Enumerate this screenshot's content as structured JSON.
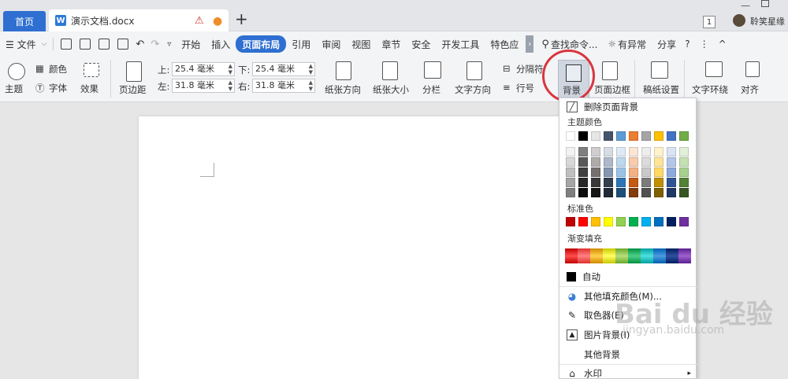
{
  "window": {
    "home_tab": "首页",
    "doc_tab": "演示文档.docx",
    "doc_icon_letter": "W",
    "new_tab": "+",
    "tab_count": "1",
    "user_name": "聆笑星缘"
  },
  "menubar": {
    "file": "☰ 文件",
    "items": [
      "开始",
      "插入",
      "页面布局",
      "引用",
      "审阅",
      "视图",
      "章节",
      "安全",
      "开发工具",
      "特色应"
    ],
    "active_item": "页面布局",
    "search": "查找命令...",
    "exception": "有异常",
    "share": "分享"
  },
  "ribbon": {
    "theme": "主题",
    "colors": "颜色",
    "fonts": "字体",
    "effects": "效果",
    "margins": "页边距",
    "top_label": "上:",
    "top_value": "25.4 毫米",
    "bottom_label": "下:",
    "bottom_value": "25.4 毫米",
    "left_label": "左:",
    "left_value": "31.8 毫米",
    "right_label": "右:",
    "right_value": "31.8 毫米",
    "orientation": "纸张方向",
    "size": "纸张大小",
    "columns": "分栏",
    "text_direction": "文字方向",
    "separator": "分隔符",
    "line_number": "行号",
    "background": "背景",
    "page_border": "页面边框",
    "paper_settings": "稿纸设置",
    "text_wrap": "文字环绕",
    "align": "对齐"
  },
  "dropdown": {
    "remove_bg": "删除页面背景",
    "theme_colors_title": "主题颜色",
    "standard_colors_title": "标准色",
    "gradient_title": "渐变填充",
    "auto": "自动",
    "more_fill": "其他填充颜色(M)...",
    "eyedropper": "取色器(E)",
    "picture_bg": "图片背景(I)",
    "other_bg": "其他背景",
    "watermark": "水印",
    "theme_top_row": [
      "#ffffff",
      "#000000",
      "#e7e6e6",
      "#44546a",
      "#5b9bd5",
      "#ed7d31",
      "#a5a5a5",
      "#ffc000",
      "#4472c4",
      "#70ad47"
    ],
    "theme_shades": [
      [
        "#f2f2f2",
        "#7f7f7f",
        "#d0cece",
        "#d6dce4",
        "#deebf6",
        "#fbe5d5",
        "#ededed",
        "#fff2cc",
        "#dae3f3",
        "#e2efd9"
      ],
      [
        "#d8d8d8",
        "#595959",
        "#aeabab",
        "#adb9ca",
        "#bdd7ee",
        "#f7cbac",
        "#dbdbdb",
        "#fee599",
        "#b4c6e7",
        "#c5e0b3"
      ],
      [
        "#bfbfbf",
        "#3f3f3f",
        "#757070",
        "#8496b0",
        "#9cc3e5",
        "#f4b183",
        "#c9c9c9",
        "#ffd965",
        "#8eaadb",
        "#a8d08d"
      ],
      [
        "#a5a5a5",
        "#262626",
        "#3a3838",
        "#323f4f",
        "#2e75b5",
        "#c55a11",
        "#7b7b7b",
        "#bf9000",
        "#2f5496",
        "#538135"
      ],
      [
        "#7f7f7f",
        "#0c0c0c",
        "#171616",
        "#222a35",
        "#1e4e79",
        "#833c0b",
        "#525252",
        "#7f6000",
        "#1f3864",
        "#375623"
      ]
    ],
    "standard_colors": [
      "#c00000",
      "#ff0000",
      "#ffc000",
      "#ffff00",
      "#92d050",
      "#00b050",
      "#00b0f0",
      "#0070c0",
      "#002060",
      "#7030a0"
    ],
    "gradients": [
      [
        "#c00000",
        "#ff4d4d"
      ],
      [
        "#e03030",
        "#ff8080"
      ],
      [
        "#d08a00",
        "#ffd24d"
      ],
      [
        "#c8c800",
        "#ffff66"
      ],
      [
        "#6aa82e",
        "#b6e07a"
      ],
      [
        "#00903f",
        "#4dd08a"
      ],
      [
        "#00a0a0",
        "#4de0e0"
      ],
      [
        "#0060b0",
        "#4d9be0"
      ],
      [
        "#001d5c",
        "#3050a0"
      ],
      [
        "#5a2090",
        "#a060d0"
      ]
    ],
    "auto_color": "#000000"
  },
  "watermark_text": {
    "brand": "Bai du 经验",
    "url": "jingyan.baidu.com"
  }
}
